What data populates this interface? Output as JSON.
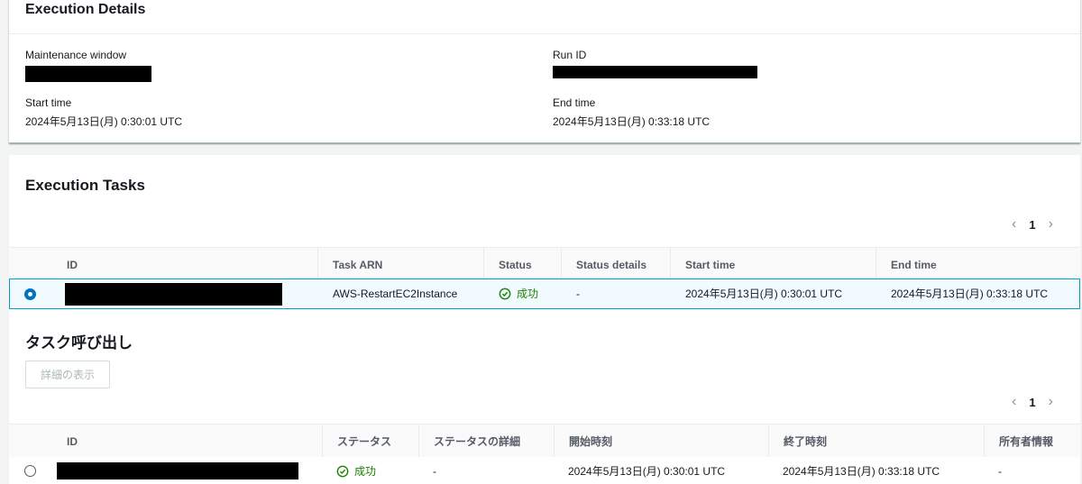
{
  "details": {
    "title": "Execution Details",
    "maintenance_window_label": "Maintenance window",
    "run_id_label": "Run ID",
    "start_time_label": "Start time",
    "start_time_value": "2024年5月13日(月) 0:30:01 UTC",
    "end_time_label": "End time",
    "end_time_value": "2024年5月13日(月) 0:33:18 UTC"
  },
  "tasks": {
    "title": "Execution Tasks",
    "page": "1",
    "columns": [
      "ID",
      "Task ARN",
      "Status",
      "Status details",
      "Start time",
      "End time"
    ],
    "rows": [
      {
        "task_arn": "AWS-RestartEC2Instance",
        "status": "成功",
        "status_details": "-",
        "start_time": "2024年5月13日(月) 0:30:01 UTC",
        "end_time": "2024年5月13日(月) 0:33:18 UTC"
      }
    ]
  },
  "invocations": {
    "title": "タスク呼び出し",
    "view_details_button": "詳細の表示",
    "page": "1",
    "columns": [
      "ID",
      "ステータス",
      "ステータスの詳細",
      "開始時刻",
      "終了時刻",
      "所有者情報"
    ],
    "rows": [
      {
        "status": "成功",
        "status_details": "-",
        "start_time": "2024年5月13日(月) 0:30:01 UTC",
        "end_time": "2024年5月13日(月) 0:33:18 UTC",
        "owner_info": "-"
      }
    ]
  },
  "colors": {
    "success": "#1d8102",
    "selected_border": "#00a1c9",
    "radio_selected": "#0073bb"
  },
  "icons": {
    "status": "check-circle-icon",
    "prev": "chevron-left-icon",
    "next": "chevron-right-icon"
  }
}
